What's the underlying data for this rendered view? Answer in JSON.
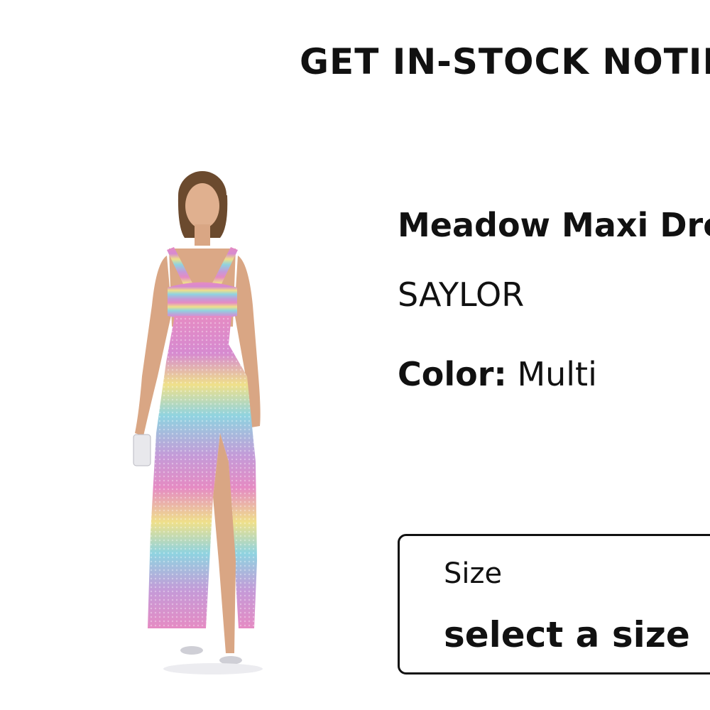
{
  "modal": {
    "title": "GET IN-STOCK NOTIFICATIONS"
  },
  "product": {
    "name": "Meadow Maxi Dress",
    "brand": "SAYLOR",
    "color_label": "Color:",
    "color_value": "Multi",
    "image_icon": "product-photo"
  },
  "size_select": {
    "label": "Size",
    "value": "select a size"
  },
  "colors": {
    "text": "#111111",
    "background": "#ffffff",
    "dress_pink": "#e58bc3",
    "dress_blue": "#8fd3e0",
    "dress_yellow": "#efe08a"
  }
}
